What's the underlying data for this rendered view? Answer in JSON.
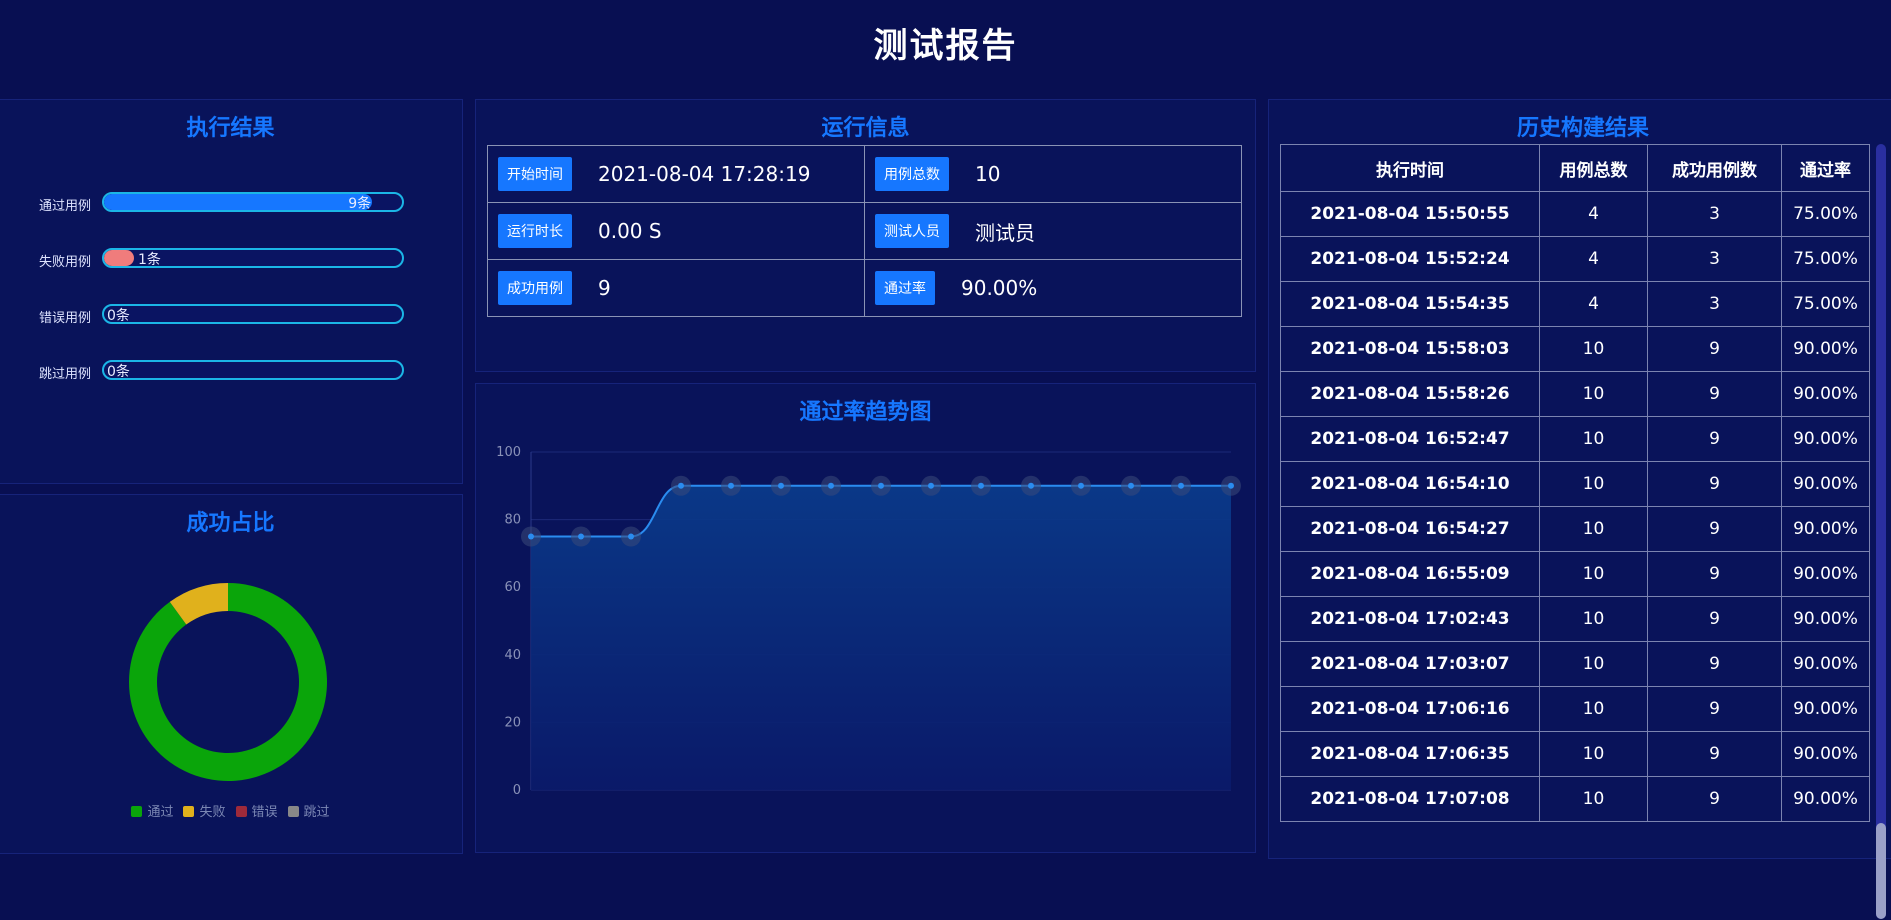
{
  "page_title": "测试报告",
  "exec_results": {
    "title": "执行结果",
    "items": [
      {
        "label": "通过用例",
        "value_text": "9条",
        "fraction": 0.9,
        "color": "#1677ff"
      },
      {
        "label": "失败用例",
        "value_text": "1条",
        "fraction": 0.1,
        "color": "#f07c7c"
      },
      {
        "label": "错误用例",
        "value_text": "0条",
        "fraction": 0.0,
        "color": "#c0392b"
      },
      {
        "label": "跳过用例",
        "value_text": "0条",
        "fraction": 0.0,
        "color": "#888888"
      }
    ]
  },
  "run_info": {
    "title": "运行信息",
    "fields": [
      {
        "label": "开始时间",
        "value": "2021-08-04 17:28:19"
      },
      {
        "label": "用例总数",
        "value": "10"
      },
      {
        "label": "运行时长",
        "value": "0.00 S"
      },
      {
        "label": "测试人员",
        "value": "测试员"
      },
      {
        "label": "成功用例",
        "value": "9"
      },
      {
        "label": "通过率",
        "value": "90.00%"
      }
    ]
  },
  "success_ratio": {
    "title": "成功占比",
    "legend": [
      {
        "name": "通过",
        "color": "#0aa50a",
        "value": 9
      },
      {
        "name": "失败",
        "color": "#e0b11c",
        "value": 1
      },
      {
        "name": "错误",
        "color": "#9e2a3a",
        "value": 0
      },
      {
        "name": "跳过",
        "color": "#888888",
        "value": 0
      }
    ]
  },
  "trend": {
    "title": "通过率趋势图"
  },
  "chart_data": {
    "type": "area",
    "title": "通过率趋势图",
    "x": [
      1,
      2,
      3,
      4,
      5,
      6,
      7,
      8,
      9,
      10,
      11,
      12,
      13,
      14,
      15
    ],
    "series": [
      {
        "values": [
          75,
          75,
          75,
          90,
          90,
          90,
          90,
          90,
          90,
          90,
          90,
          90,
          90,
          90,
          90
        ]
      }
    ],
    "ylim": [
      0,
      100
    ],
    "yticks": [
      "0",
      "20",
      "40",
      "60",
      "80",
      "100"
    ],
    "grid": true
  },
  "history": {
    "title": "历史构建结果",
    "columns": [
      "执行时间",
      "用例总数",
      "成功用例数",
      "通过率"
    ],
    "rows": [
      [
        "2021-08-04 15:50:55",
        "4",
        "3",
        "75.00%"
      ],
      [
        "2021-08-04 15:52:24",
        "4",
        "3",
        "75.00%"
      ],
      [
        "2021-08-04 15:54:35",
        "4",
        "3",
        "75.00%"
      ],
      [
        "2021-08-04 15:58:03",
        "10",
        "9",
        "90.00%"
      ],
      [
        "2021-08-04 15:58:26",
        "10",
        "9",
        "90.00%"
      ],
      [
        "2021-08-04 16:52:47",
        "10",
        "9",
        "90.00%"
      ],
      [
        "2021-08-04 16:54:10",
        "10",
        "9",
        "90.00%"
      ],
      [
        "2021-08-04 16:54:27",
        "10",
        "9",
        "90.00%"
      ],
      [
        "2021-08-04 16:55:09",
        "10",
        "9",
        "90.00%"
      ],
      [
        "2021-08-04 17:02:43",
        "10",
        "9",
        "90.00%"
      ],
      [
        "2021-08-04 17:03:07",
        "10",
        "9",
        "90.00%"
      ],
      [
        "2021-08-04 17:06:16",
        "10",
        "9",
        "90.00%"
      ],
      [
        "2021-08-04 17:06:35",
        "10",
        "9",
        "90.00%"
      ],
      [
        "2021-08-04 17:07:08",
        "10",
        "9",
        "90.00%"
      ]
    ]
  }
}
